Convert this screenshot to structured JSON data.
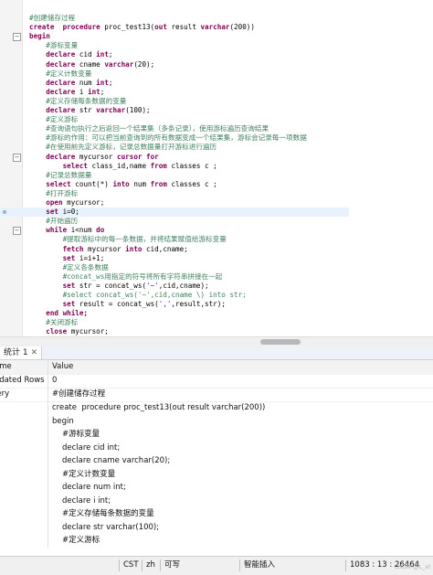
{
  "editor": {
    "lines": [
      {
        "tokens": [
          {
            "t": "#创建储存过程",
            "c": "cm"
          }
        ]
      },
      {
        "tokens": [
          {
            "t": "create  procedure ",
            "c": "kw"
          },
          {
            "t": "proc_test13(",
            "c": "fn"
          },
          {
            "t": "out",
            "c": "kw"
          },
          {
            "t": " result ",
            "c": "fn"
          },
          {
            "t": "varchar",
            "c": "kw"
          },
          {
            "t": "(200))",
            "c": "fn"
          }
        ]
      },
      {
        "tokens": [
          {
            "t": "begin",
            "c": "kw"
          }
        ]
      },
      {
        "tokens": [
          {
            "t": "    #游标变量",
            "c": "cm"
          }
        ]
      },
      {
        "tokens": [
          {
            "t": "    declare ",
            "c": "kw"
          },
          {
            "t": "cid ",
            "c": "fn"
          },
          {
            "t": "int",
            "c": "kw"
          },
          {
            "t": ";",
            "c": "fn"
          }
        ]
      },
      {
        "tokens": [
          {
            "t": "    declare ",
            "c": "kw"
          },
          {
            "t": "cname ",
            "c": "fn"
          },
          {
            "t": "varchar",
            "c": "kw"
          },
          {
            "t": "(20);",
            "c": "fn"
          }
        ]
      },
      {
        "tokens": [
          {
            "t": "    #定义计数变量",
            "c": "cm"
          }
        ]
      },
      {
        "tokens": [
          {
            "t": "    declare ",
            "c": "kw"
          },
          {
            "t": "num ",
            "c": "fn"
          },
          {
            "t": "int",
            "c": "kw"
          },
          {
            "t": ";",
            "c": "fn"
          }
        ]
      },
      {
        "tokens": [
          {
            "t": "    declare ",
            "c": "kw"
          },
          {
            "t": "i ",
            "c": "fn"
          },
          {
            "t": "int",
            "c": "kw"
          },
          {
            "t": ";",
            "c": "fn"
          }
        ]
      },
      {
        "tokens": [
          {
            "t": "    #定义存储每条数据的变量",
            "c": "cm"
          }
        ]
      },
      {
        "tokens": [
          {
            "t": "    declare ",
            "c": "kw"
          },
          {
            "t": "str ",
            "c": "fn"
          },
          {
            "t": "varchar",
            "c": "kw"
          },
          {
            "t": "(100);",
            "c": "fn"
          }
        ]
      },
      {
        "tokens": [
          {
            "t": "    #定义游标",
            "c": "cm"
          }
        ]
      },
      {
        "tokens": [
          {
            "t": "    #查询语句执行之后返回一个结果集（多条记录），使用游标遍历查询结果",
            "c": "cm"
          }
        ]
      },
      {
        "tokens": [
          {
            "t": "    #游标的作用：可以把当前查询到的所有数据变成一个结果集，游标会记录每一项数据",
            "c": "cm"
          }
        ]
      },
      {
        "tokens": [
          {
            "t": "    #在使用前先定义游标，记录总数据量打开游标进行遍历",
            "c": "cm"
          }
        ]
      },
      {
        "tokens": [
          {
            "t": "    declare ",
            "c": "kw"
          },
          {
            "t": "mycursor ",
            "c": "fn"
          },
          {
            "t": "cursor for",
            "c": "kw"
          }
        ]
      },
      {
        "tokens": [
          {
            "t": "        select ",
            "c": "kw"
          },
          {
            "t": "class_id,name ",
            "c": "fn"
          },
          {
            "t": "from ",
            "c": "kw"
          },
          {
            "t": "classes c ;",
            "c": "fn"
          }
        ]
      },
      {
        "tokens": [
          {
            "t": "    #记录总数据量",
            "c": "cm"
          }
        ]
      },
      {
        "tokens": [
          {
            "t": "    select ",
            "c": "kw"
          },
          {
            "t": "count(*) ",
            "c": "fn"
          },
          {
            "t": "into ",
            "c": "kw"
          },
          {
            "t": "num ",
            "c": "fn"
          },
          {
            "t": "from ",
            "c": "kw"
          },
          {
            "t": "classes c ;",
            "c": "fn"
          }
        ]
      },
      {
        "tokens": [
          {
            "t": "    #打开游标",
            "c": "cm"
          }
        ]
      },
      {
        "tokens": [
          {
            "t": "    open ",
            "c": "kw"
          },
          {
            "t": "mycursor;",
            "c": "fn"
          }
        ]
      },
      {
        "tokens": [
          {
            "t": "    set ",
            "c": "kw"
          },
          {
            "t": "i=0;",
            "c": "fn"
          }
        ],
        "current": true
      },
      {
        "tokens": [
          {
            "t": "    #开始遍历",
            "c": "cm"
          }
        ]
      },
      {
        "tokens": [
          {
            "t": "    while ",
            "c": "kw"
          },
          {
            "t": "i<num ",
            "c": "fn"
          },
          {
            "t": "do",
            "c": "kw"
          }
        ]
      },
      {
        "tokens": [
          {
            "t": "        #提取游标中的每一条数据，并将结果赋值给游标变量",
            "c": "cm"
          }
        ]
      },
      {
        "tokens": [
          {
            "t": "        fetch ",
            "c": "kw"
          },
          {
            "t": "mycursor ",
            "c": "fn"
          },
          {
            "t": "into ",
            "c": "kw"
          },
          {
            "t": "cid,cname;",
            "c": "fn"
          }
        ]
      },
      {
        "tokens": [
          {
            "t": "        set ",
            "c": "kw"
          },
          {
            "t": "i=i+1;",
            "c": "fn"
          }
        ]
      },
      {
        "tokens": [
          {
            "t": "        #定义各条数据",
            "c": "cm"
          }
        ]
      },
      {
        "tokens": [
          {
            "t": "        #concat_ws用指定的符号将所有字符串拼接在一起",
            "c": "cm"
          }
        ]
      },
      {
        "tokens": [
          {
            "t": "        set ",
            "c": "kw"
          },
          {
            "t": "str = concat_ws(",
            "c": "fn"
          },
          {
            "t": "'~'",
            "c": "str"
          },
          {
            "t": ",cid,cname);",
            "c": "fn"
          }
        ]
      },
      {
        "tokens": [
          {
            "t": "        #select concat_ws('~',cid,cname \\) into str;",
            "c": "cm"
          }
        ]
      },
      {
        "tokens": [
          {
            "t": "        set ",
            "c": "kw"
          },
          {
            "t": "result = concat_ws(",
            "c": "fn"
          },
          {
            "t": "','",
            "c": "str"
          },
          {
            "t": ",result,str);",
            "c": "fn"
          }
        ]
      },
      {
        "tokens": [
          {
            "t": "    end while;",
            "c": "kw"
          }
        ]
      },
      {
        "tokens": [
          {
            "t": "    #关闭游标",
            "c": "cm"
          }
        ]
      },
      {
        "tokens": [
          {
            "t": "    close ",
            "c": "kw"
          },
          {
            "t": "mycursor;",
            "c": "fn"
          }
        ]
      }
    ]
  },
  "tabs": {
    "active_label": "统计 1",
    "close_glyph": "✕"
  },
  "grid": {
    "header": {
      "name": "ame",
      "value": "Value"
    },
    "rows": [
      {
        "name": "odated Rows",
        "value": "0"
      },
      {
        "name": "iery",
        "value": "#创建储存过程"
      }
    ],
    "query_lines": [
      {
        "text": "create  procedure proc_test13(out result varchar(200))",
        "indent": false
      },
      {
        "text": "begin",
        "indent": false
      },
      {
        "text": "#游标变量",
        "indent": true
      },
      {
        "text": "declare cid int;",
        "indent": true
      },
      {
        "text": "declare cname varchar(20);",
        "indent": true
      },
      {
        "text": "#定义计数变量",
        "indent": true
      },
      {
        "text": "declare num int;",
        "indent": true
      },
      {
        "text": "declare i int;",
        "indent": true
      },
      {
        "text": "#定义存储每条数据的变量",
        "indent": true
      },
      {
        "text": "declare str varchar(100);",
        "indent": true
      },
      {
        "text": "#定义游标",
        "indent": true
      }
    ]
  },
  "status": {
    "timezone": "CST",
    "lang": "zh",
    "mode": "可写",
    "insert": "智能插入",
    "position": "1083 : 13 : 26464",
    "watermark": "CSDN @L_xl"
  },
  "colors": {
    "keyword": "#7f0055",
    "comment": "#3f7f5f",
    "string": "#2a00ff",
    "current_line": "#e8f2fe"
  }
}
